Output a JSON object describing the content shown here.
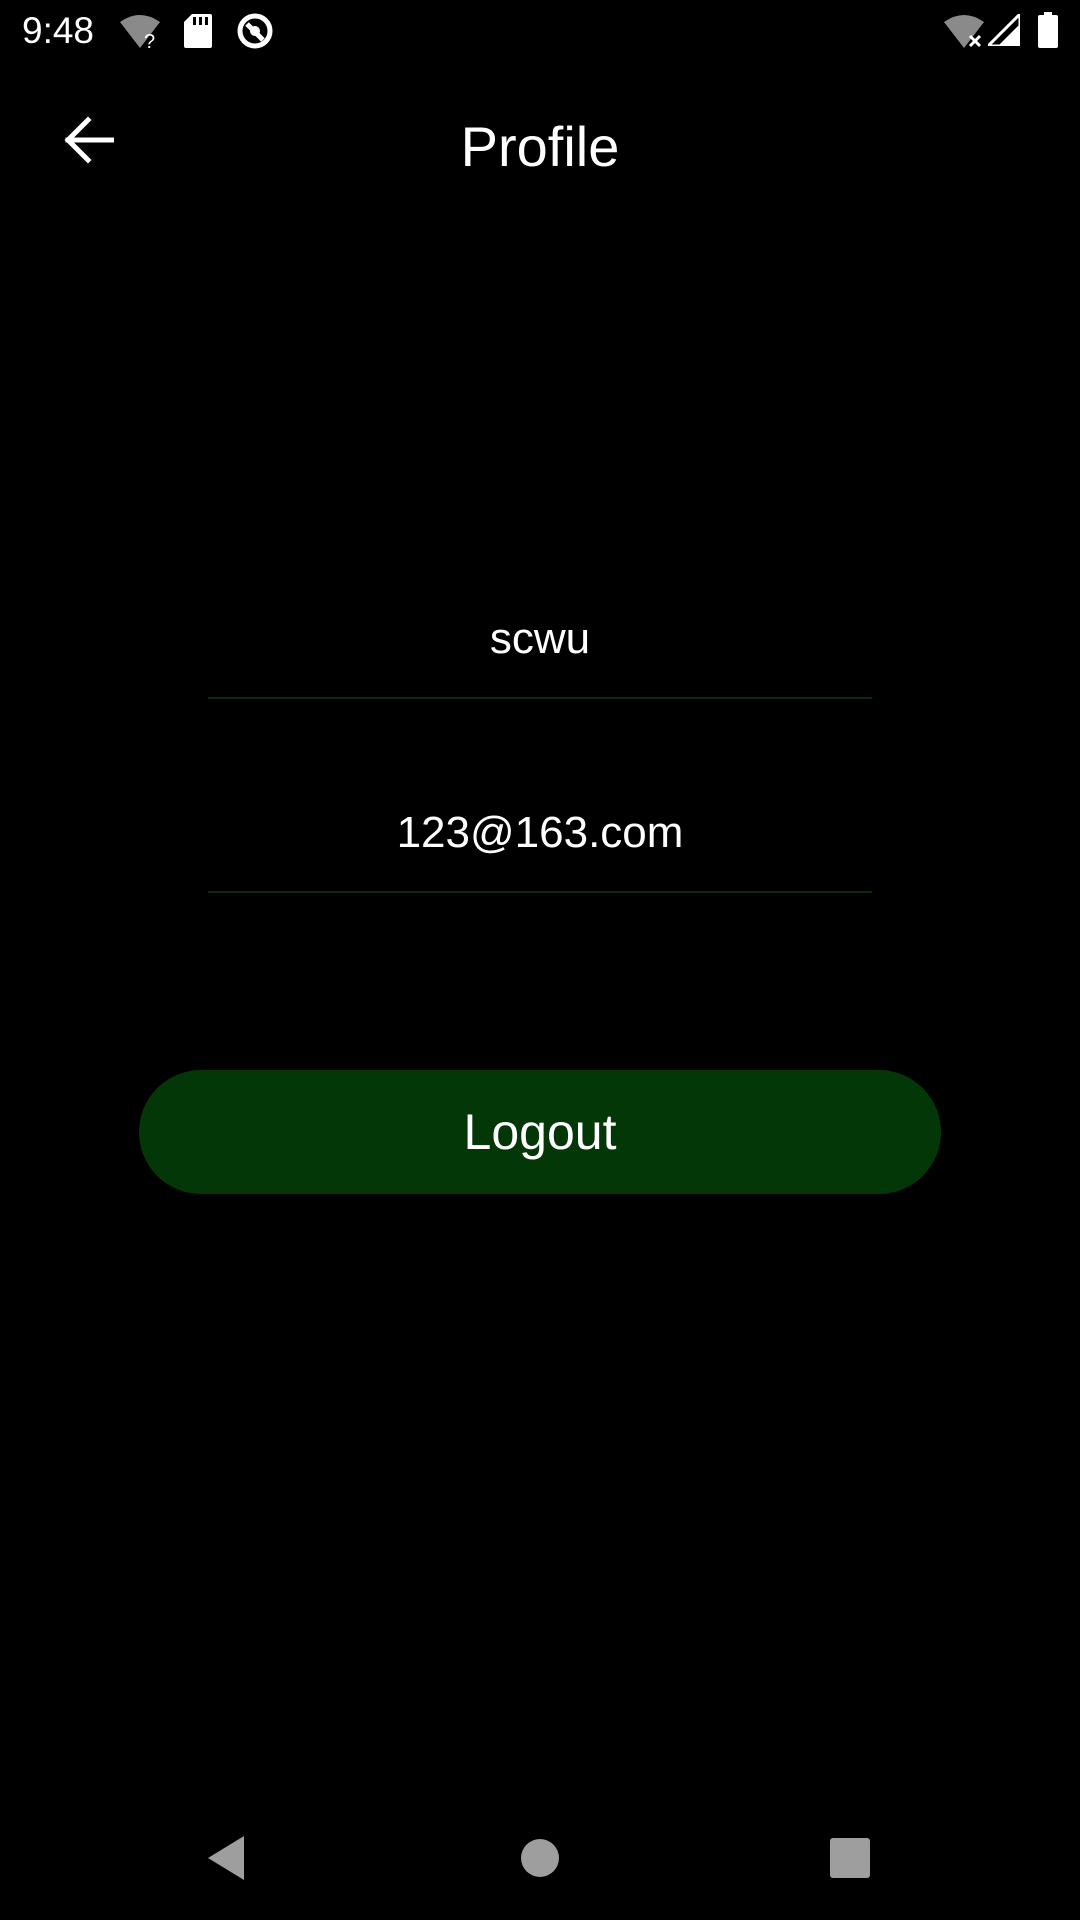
{
  "status_bar": {
    "time": "9:48",
    "icons_left": [
      "wifi-unknown-icon",
      "sd-card-icon",
      "sync-icon"
    ],
    "icons_right": [
      "wifi-off-icon",
      "signal-icon",
      "battery-icon"
    ]
  },
  "app_bar": {
    "back_icon": "arrow-back-icon",
    "title": "Profile"
  },
  "profile": {
    "username": "scwu",
    "email": "123@163.com"
  },
  "actions": {
    "logout_label": "Logout"
  },
  "nav_bar": {
    "buttons": [
      "back-triangle-icon",
      "home-circle-icon",
      "recents-square-icon"
    ]
  },
  "colors": {
    "background": "#000000",
    "button": "#033707",
    "divider": "#0d2a10",
    "nav_icons": "#9e9e9e"
  }
}
